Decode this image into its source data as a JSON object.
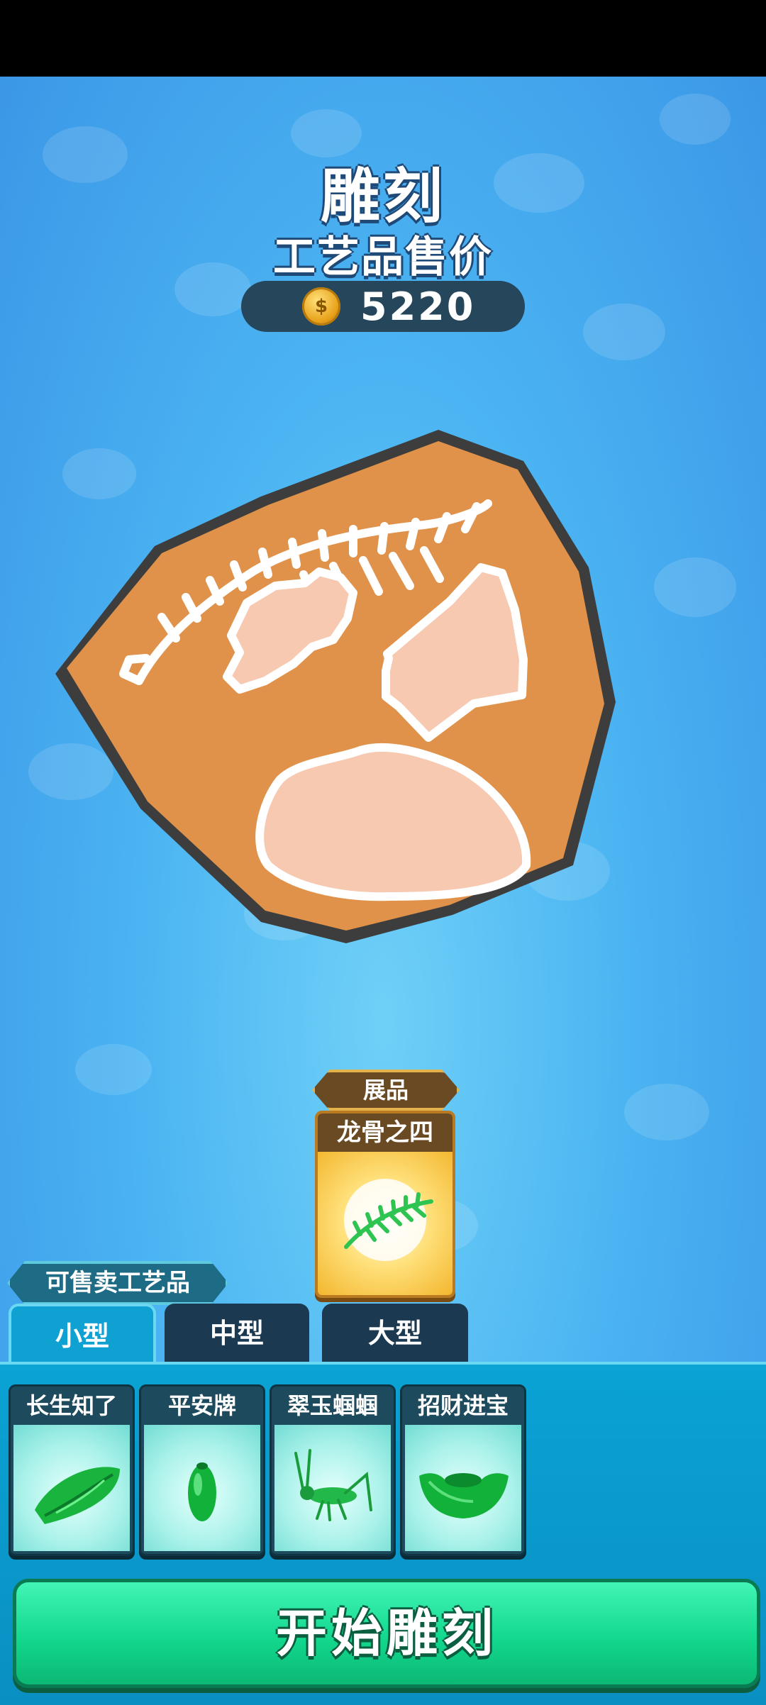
{
  "header": {
    "title": "雕刻",
    "subtitle": "工艺品售价",
    "price": "5220",
    "coin_icon": "coin-icon"
  },
  "exhibit": {
    "tag": "展品",
    "name": "龙骨之四",
    "icon": "dragon-bone-icon"
  },
  "sellable": {
    "label": "可售卖工艺品",
    "tabs": [
      {
        "label": "小型",
        "active": true
      },
      {
        "label": "中型",
        "active": false
      },
      {
        "label": "大型",
        "active": false
      }
    ],
    "items": [
      {
        "name": "长生知了",
        "icon": "jade-cicada-icon"
      },
      {
        "name": "平安牌",
        "icon": "jade-pendant-icon"
      },
      {
        "name": "翠玉蝈蝈",
        "icon": "jade-grasshopper-icon"
      },
      {
        "name": "招财进宝",
        "icon": "jade-ingot-icon"
      }
    ]
  },
  "start_button": "开始雕刻",
  "colors": {
    "background": "#4bb4f2",
    "stone": "#e0924a",
    "start_button": "#13d88e",
    "panel": "#0aa3d4"
  }
}
